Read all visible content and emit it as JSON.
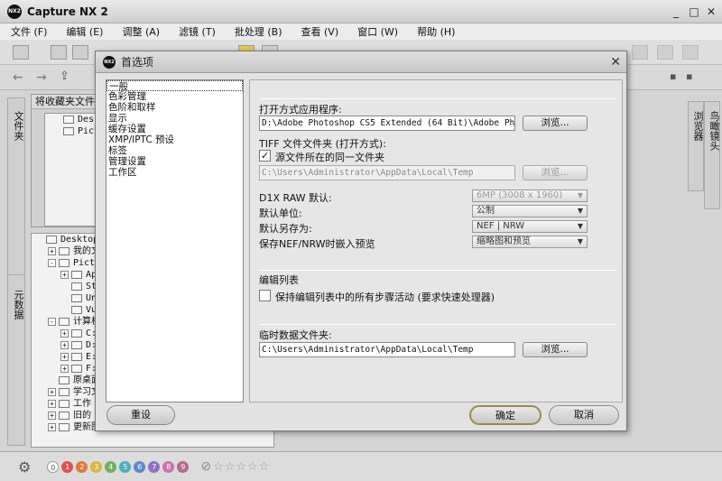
{
  "app": {
    "title": "Capture NX 2",
    "logo_text": "NX2"
  },
  "window_controls": {
    "minimize": "_",
    "maximize": "□",
    "close": "✕"
  },
  "menu": [
    "文件 (F)",
    "编辑 (E)",
    "调整 (A)",
    "滤镜 (T)",
    "批处理 (B)",
    "查看 (V)",
    "窗口 (W)",
    "帮助 (H)"
  ],
  "left_panel": {
    "vertical_tab": "文件夹",
    "favorites_header": "将收藏夹文件夹",
    "favorites": [
      "Desktop",
      "Picture"
    ],
    "meta_tab": "元数据",
    "tree": [
      {
        "label": "Desktop",
        "indent": 0,
        "exp": ""
      },
      {
        "label": "我的文档",
        "indent": 1,
        "exp": "+"
      },
      {
        "label": "Picture",
        "indent": 1,
        "exp": "-"
      },
      {
        "label": "Apow",
        "indent": 2,
        "exp": "+"
      },
      {
        "label": "Stel",
        "indent": 2,
        "exp": ""
      },
      {
        "label": "Unis",
        "indent": 2,
        "exp": ""
      },
      {
        "label": "VueS",
        "indent": 2,
        "exp": ""
      },
      {
        "label": "计算机",
        "indent": 1,
        "exp": "-"
      },
      {
        "label": "C:\\",
        "indent": 2,
        "exp": "+"
      },
      {
        "label": "D:\\",
        "indent": 2,
        "exp": "+"
      },
      {
        "label": "E:\\",
        "indent": 2,
        "exp": "+"
      },
      {
        "label": "F:\\",
        "indent": 2,
        "exp": "+"
      },
      {
        "label": "原桌面",
        "indent": 1,
        "exp": ""
      },
      {
        "label": "学习文件",
        "indent": 1,
        "exp": "+"
      },
      {
        "label": "工作",
        "indent": 1,
        "exp": "+"
      },
      {
        "label": "旧的 Fi",
        "indent": 1,
        "exp": "+"
      },
      {
        "label": "更新图片",
        "indent": 1,
        "exp": "+"
      }
    ]
  },
  "right_panel": {
    "browser_tab": "浏览器",
    "birdseye_tab": "鸟瞰镜头"
  },
  "bottom": {
    "labels": [
      {
        "n": "0",
        "c": "#ffffff"
      },
      {
        "n": "1",
        "c": "#e05050"
      },
      {
        "n": "2",
        "c": "#e07a3a"
      },
      {
        "n": "3",
        "c": "#d8b840"
      },
      {
        "n": "4",
        "c": "#70b060"
      },
      {
        "n": "5",
        "c": "#4ab0c0"
      },
      {
        "n": "6",
        "c": "#5a88d0"
      },
      {
        "n": "7",
        "c": "#9070c8"
      },
      {
        "n": "8",
        "c": "#d070a8"
      },
      {
        "n": "9",
        "c": "#b86a8a"
      }
    ]
  },
  "dialog": {
    "title": "首选项",
    "close": "✕",
    "categories": [
      "一般",
      "色彩管理",
      "色阶和取样",
      "显示",
      "缓存设置",
      "XMP/IPTC 预设",
      "标签",
      "管理设置",
      "工作区"
    ],
    "selected_category": "一般",
    "open_app_label": "打开方式应用程序:",
    "open_app_value": "D:\\Adobe Photoshop CS5 Extended (64 Bit)\\Adobe Photoshop",
    "browse1": "浏览...",
    "tiff_label": "TIFF 文件文件夹 (打开方式):",
    "same_folder_label": "源文件所在的同一文件夹",
    "same_folder_checked": "✓",
    "tiff_value": "C:\\Users\\Administrator\\AppData\\Local\\Temp",
    "browse2": "浏览...",
    "d1x_label": "D1X RAW 默认:",
    "d1x_value": "6MP (3008 x 1960)",
    "unit_label": "默认单位:",
    "unit_value": "公制",
    "saveas_label": "默认另存为:",
    "saveas_value": "NEF | NRW",
    "embed_label": "保存NEF/NRW时嵌入预览",
    "embed_value": "缩略图和预览",
    "editlist_title": "编辑列表",
    "editlist_option": "保持编辑列表中的所有步骤活动 (要求快速处理器)",
    "temp_title": "临时数据文件夹:",
    "temp_value": "C:\\Users\\Administrator\\AppData\\Local\\Temp",
    "browse3": "浏览...",
    "reset": "重设",
    "ok": "确定",
    "cancel": "取消"
  }
}
